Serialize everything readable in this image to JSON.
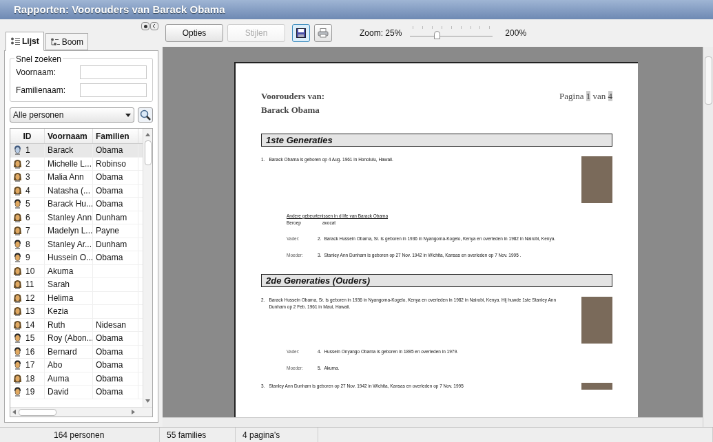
{
  "window": {
    "title": "Rapporten: Voorouders van Barack Obama"
  },
  "sidebar": {
    "tabs": [
      {
        "label": "Lijst",
        "selected": true
      },
      {
        "label": "Boom",
        "selected": false
      }
    ],
    "quick_search": {
      "title": "Snel zoeken",
      "fields": [
        {
          "label": "Voornaam:"
        },
        {
          "label": "Familienaam:"
        }
      ]
    },
    "filter": {
      "value": "Alle personen"
    },
    "table": {
      "columns": [
        "ID",
        "Voornaam",
        "Familien"
      ],
      "rows": [
        {
          "kind": "male",
          "selected": true,
          "cells": [
            "1",
            "Barack",
            "Obama"
          ]
        },
        {
          "kind": "female",
          "selected": false,
          "cells": [
            "2",
            "Michelle L...",
            "Robinso"
          ]
        },
        {
          "kind": "female",
          "selected": false,
          "cells": [
            "3",
            "Malia Ann",
            "Obama"
          ]
        },
        {
          "kind": "female",
          "selected": false,
          "cells": [
            "4",
            "Natasha (...",
            "Obama"
          ]
        },
        {
          "kind": "male",
          "selected": false,
          "cells": [
            "5",
            "Barack Hu...",
            "Obama"
          ]
        },
        {
          "kind": "female",
          "selected": false,
          "cells": [
            "6",
            "Stanley Ann",
            "Dunham"
          ]
        },
        {
          "kind": "female",
          "selected": false,
          "cells": [
            "7",
            "Madelyn L...",
            "Payne"
          ]
        },
        {
          "kind": "male",
          "selected": false,
          "cells": [
            "8",
            "Stanley Ar...",
            "Dunham"
          ]
        },
        {
          "kind": "male",
          "selected": false,
          "cells": [
            "9",
            "Hussein O...",
            "Obama"
          ]
        },
        {
          "kind": "female",
          "selected": false,
          "cells": [
            "10",
            "Akuma",
            ""
          ]
        },
        {
          "kind": "female",
          "selected": false,
          "cells": [
            "11",
            "Sarah",
            ""
          ]
        },
        {
          "kind": "female",
          "selected": false,
          "cells": [
            "12",
            "Helima",
            ""
          ]
        },
        {
          "kind": "female",
          "selected": false,
          "cells": [
            "13",
            "Kezia",
            ""
          ]
        },
        {
          "kind": "female",
          "selected": false,
          "cells": [
            "14",
            "Ruth",
            "Nidesan"
          ]
        },
        {
          "kind": "male",
          "selected": false,
          "cells": [
            "15",
            "Roy (Abon...",
            "Obama"
          ]
        },
        {
          "kind": "male",
          "selected": false,
          "cells": [
            "16",
            "Bernard",
            "Obama"
          ]
        },
        {
          "kind": "male",
          "selected": false,
          "cells": [
            "17",
            "Abo",
            "Obama"
          ]
        },
        {
          "kind": "female",
          "selected": false,
          "cells": [
            "18",
            "Auma",
            "Obama"
          ]
        },
        {
          "kind": "male",
          "selected": false,
          "cells": [
            "19",
            "David",
            "Obama"
          ]
        }
      ]
    }
  },
  "toolbar": {
    "buttons": [
      {
        "kind": "text",
        "label": "Opties",
        "disabled": false,
        "selected": false
      },
      {
        "kind": "text",
        "label": "Stijlen",
        "disabled": true,
        "selected": false
      },
      {
        "kind": "save",
        "disabled": false,
        "selected": true
      },
      {
        "kind": "print",
        "disabled": false,
        "selected": false
      }
    ],
    "zoom": {
      "label": "Zoom: 25%",
      "max_label": "200%",
      "level": 0.32
    }
  },
  "report": {
    "title_lines": [
      "Voorouders van:",
      "Barack Obama"
    ],
    "page": {
      "prefix": "Pagina",
      "current": "1",
      "middle": "van",
      "total": "4"
    },
    "generations": [
      {
        "title": "1ste Generaties",
        "entries": [
          {
            "number": "1.",
            "text": "Barack Obama is geboren op 4 Aug. 1961  in Honolulu, Hawaii.",
            "events": {
              "heading": "Andere gebeurtenissen in d life van Barack Obama",
              "rows": [
                {
                  "label": "Beroep",
                  "value": "avocat"
                }
              ]
            },
            "parents": [
              {
                "label": "Vader:",
                "number": "2.",
                "text": "Barack Hussein Obama, Sr. is geboren in 1936 in Nyangoma-Kogelo, Kenya en overleden in 1982 in Nairobi, Kenya."
              },
              {
                "label": "Moeder:",
                "number": "3.",
                "text": "Stanley Ann Dunham is geboren op 27 Nov. 1942  in Wichita, Kansas en overleden op 7 Nov. 1995 ."
              }
            ]
          }
        ]
      },
      {
        "title": "2de Generaties (Ouders)",
        "entries": [
          {
            "number": "2.",
            "text": "Barack Hussein Obama, Sr. is geboren in 1936 in Nyangoma-Kogelo, Kenya en overleden in 1982 in Nairobi, Kenya. Hij huwde 1ste Stanley Ann Dunham op 2 Feb. 1961  in Maui, Hawaii.",
            "parents": [
              {
                "label": "Vader:",
                "number": "4.",
                "text": "Hussein Onyango Obama is geboren in 1895 en overleden in 1979."
              },
              {
                "label": "Moeder:",
                "number": "5.",
                "text": "Akuma."
              }
            ]
          },
          {
            "number": "3.",
            "text": "Stanley Ann Dunham is geboren op 27 Nov. 1942  in Wichita, Kansas en overleden op 7 Nov. 1995"
          }
        ]
      }
    ]
  },
  "status_bar": [
    "164 personen",
    "55 families",
    "4 pagina's"
  ]
}
